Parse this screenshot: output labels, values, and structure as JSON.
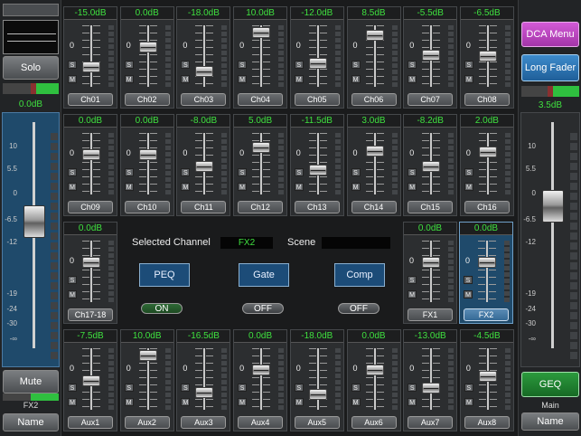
{
  "colors": {
    "level_green": "#3fe03f",
    "selected_blue": "#1f4a6b",
    "dca_magenta": "#c443c8",
    "long_fader_blue": "#2f78b8",
    "geq_green": "#1f7a2e"
  },
  "left": {
    "solo_label": "Solo",
    "level": "0.0dB",
    "scale": [
      "10",
      "5.5",
      "0",
      "-6.5",
      "-12",
      "-19",
      "-24",
      "-30",
      "-∞"
    ],
    "fader_level": 0.56,
    "mute_label": "Mute",
    "channel_label": "FX2",
    "name_label": "Name"
  },
  "right": {
    "dca_label": "DCA Menu",
    "long_fader_label": "Long Fader",
    "level": "3.5dB",
    "scale": [
      "10",
      "5.5",
      "0",
      "-6.5",
      "-12",
      "-19",
      "-24",
      "-30",
      "-∞"
    ],
    "fader_level": 0.63,
    "geq_label": "GEQ",
    "main_label": "Main",
    "name_label": "Name"
  },
  "row1": [
    {
      "name": "Ch01",
      "db": "-15.0dB",
      "level": 0.32
    },
    {
      "name": "Ch02",
      "db": "0.0dB",
      "level": 0.64
    },
    {
      "name": "Ch03",
      "db": "-18.0dB",
      "level": 0.25
    },
    {
      "name": "Ch04",
      "db": "10.0dB",
      "level": 0.88
    },
    {
      "name": "Ch05",
      "db": "-12.0dB",
      "level": 0.38
    },
    {
      "name": "Ch06",
      "db": "8.5dB",
      "level": 0.84
    },
    {
      "name": "Ch07",
      "db": "-5.5dB",
      "level": 0.52
    },
    {
      "name": "Ch08",
      "db": "-6.5dB",
      "level": 0.5
    }
  ],
  "row2": [
    {
      "name": "Ch09",
      "db": "0.0dB",
      "level": 0.64
    },
    {
      "name": "Ch10",
      "db": "0.0dB",
      "level": 0.64
    },
    {
      "name": "Ch11",
      "db": "-8.0dB",
      "level": 0.46
    },
    {
      "name": "Ch12",
      "db": "5.0dB",
      "level": 0.76
    },
    {
      "name": "Ch13",
      "db": "-11.5dB",
      "level": 0.39
    },
    {
      "name": "Ch14",
      "db": "3.0dB",
      "level": 0.71
    },
    {
      "name": "Ch15",
      "db": "-8.2dB",
      "level": 0.46
    },
    {
      "name": "Ch16",
      "db": "2.0dB",
      "level": 0.69
    }
  ],
  "row3": [
    {
      "name": "Ch17-18",
      "db": "0.0dB",
      "level": 0.64
    },
    {
      "name": "FX1",
      "db": "0.0dB",
      "level": 0.64
    },
    {
      "name": "FX2",
      "db": "0.0dB",
      "level": 0.64,
      "selected": true
    }
  ],
  "row4": [
    {
      "name": "Aux1",
      "db": "-7.5dB",
      "level": 0.47
    },
    {
      "name": "Aux2",
      "db": "10.0dB",
      "level": 0.88
    },
    {
      "name": "Aux3",
      "db": "-16.5dB",
      "level": 0.28
    },
    {
      "name": "Aux4",
      "db": "0.0dB",
      "level": 0.64
    },
    {
      "name": "Aux5",
      "db": "-18.0dB",
      "level": 0.25
    },
    {
      "name": "Aux6",
      "db": "0.0dB",
      "level": 0.64
    },
    {
      "name": "Aux7",
      "db": "-13.0dB",
      "level": 0.35
    },
    {
      "name": "Aux8",
      "db": "-4.5dB",
      "level": 0.55
    }
  ],
  "strip_labels": {
    "zero": "0",
    "solo": "S",
    "mute": "M"
  },
  "center": {
    "selected_label": "Selected Channel",
    "selected_value": "FX2",
    "scene_label": "Scene",
    "scene_value": "",
    "peq_label": "PEQ",
    "gate_label": "Gate",
    "comp_label": "Comp",
    "peq_state": "ON",
    "gate_state": "OFF",
    "comp_state": "OFF"
  }
}
